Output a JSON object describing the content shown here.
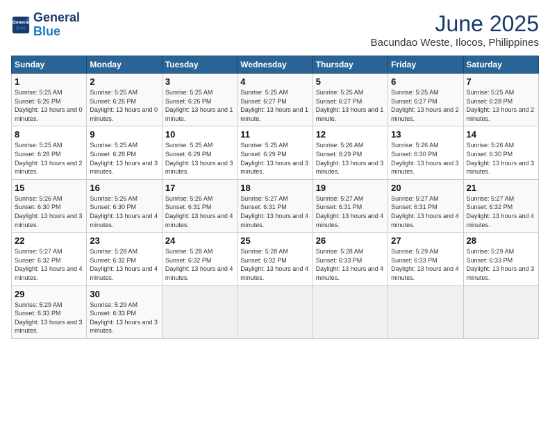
{
  "header": {
    "logo_line1": "General",
    "logo_line2": "Blue",
    "title": "June 2025",
    "subtitle": "Bacundao Weste, Ilocos, Philippines"
  },
  "calendar": {
    "days_of_week": [
      "Sunday",
      "Monday",
      "Tuesday",
      "Wednesday",
      "Thursday",
      "Friday",
      "Saturday"
    ],
    "weeks": [
      [
        {
          "day": "1",
          "info": "Sunrise: 5:25 AM\nSunset: 6:26 PM\nDaylight: 13 hours and 0 minutes."
        },
        {
          "day": "2",
          "info": "Sunrise: 5:25 AM\nSunset: 6:26 PM\nDaylight: 13 hours and 0 minutes."
        },
        {
          "day": "3",
          "info": "Sunrise: 5:25 AM\nSunset: 6:26 PM\nDaylight: 13 hours and 1 minute."
        },
        {
          "day": "4",
          "info": "Sunrise: 5:25 AM\nSunset: 6:27 PM\nDaylight: 13 hours and 1 minute."
        },
        {
          "day": "5",
          "info": "Sunrise: 5:25 AM\nSunset: 6:27 PM\nDaylight: 13 hours and 1 minute."
        },
        {
          "day": "6",
          "info": "Sunrise: 5:25 AM\nSunset: 6:27 PM\nDaylight: 13 hours and 2 minutes."
        },
        {
          "day": "7",
          "info": "Sunrise: 5:25 AM\nSunset: 6:28 PM\nDaylight: 13 hours and 2 minutes."
        }
      ],
      [
        {
          "day": "8",
          "info": "Sunrise: 5:25 AM\nSunset: 6:28 PM\nDaylight: 13 hours and 2 minutes."
        },
        {
          "day": "9",
          "info": "Sunrise: 5:25 AM\nSunset: 6:28 PM\nDaylight: 13 hours and 3 minutes."
        },
        {
          "day": "10",
          "info": "Sunrise: 5:25 AM\nSunset: 6:29 PM\nDaylight: 13 hours and 3 minutes."
        },
        {
          "day": "11",
          "info": "Sunrise: 5:25 AM\nSunset: 6:29 PM\nDaylight: 13 hours and 3 minutes."
        },
        {
          "day": "12",
          "info": "Sunrise: 5:26 AM\nSunset: 6:29 PM\nDaylight: 13 hours and 3 minutes."
        },
        {
          "day": "13",
          "info": "Sunrise: 5:26 AM\nSunset: 6:30 PM\nDaylight: 13 hours and 3 minutes."
        },
        {
          "day": "14",
          "info": "Sunrise: 5:26 AM\nSunset: 6:30 PM\nDaylight: 13 hours and 3 minutes."
        }
      ],
      [
        {
          "day": "15",
          "info": "Sunrise: 5:26 AM\nSunset: 6:30 PM\nDaylight: 13 hours and 3 minutes."
        },
        {
          "day": "16",
          "info": "Sunrise: 5:26 AM\nSunset: 6:30 PM\nDaylight: 13 hours and 4 minutes."
        },
        {
          "day": "17",
          "info": "Sunrise: 5:26 AM\nSunset: 6:31 PM\nDaylight: 13 hours and 4 minutes."
        },
        {
          "day": "18",
          "info": "Sunrise: 5:27 AM\nSunset: 6:31 PM\nDaylight: 13 hours and 4 minutes."
        },
        {
          "day": "19",
          "info": "Sunrise: 5:27 AM\nSunset: 6:31 PM\nDaylight: 13 hours and 4 minutes."
        },
        {
          "day": "20",
          "info": "Sunrise: 5:27 AM\nSunset: 6:31 PM\nDaylight: 13 hours and 4 minutes."
        },
        {
          "day": "21",
          "info": "Sunrise: 5:27 AM\nSunset: 6:32 PM\nDaylight: 13 hours and 4 minutes."
        }
      ],
      [
        {
          "day": "22",
          "info": "Sunrise: 5:27 AM\nSunset: 6:32 PM\nDaylight: 13 hours and 4 minutes."
        },
        {
          "day": "23",
          "info": "Sunrise: 5:28 AM\nSunset: 6:32 PM\nDaylight: 13 hours and 4 minutes."
        },
        {
          "day": "24",
          "info": "Sunrise: 5:28 AM\nSunset: 6:32 PM\nDaylight: 13 hours and 4 minutes."
        },
        {
          "day": "25",
          "info": "Sunrise: 5:28 AM\nSunset: 6:32 PM\nDaylight: 13 hours and 4 minutes."
        },
        {
          "day": "26",
          "info": "Sunrise: 5:28 AM\nSunset: 6:33 PM\nDaylight: 13 hours and 4 minutes."
        },
        {
          "day": "27",
          "info": "Sunrise: 5:29 AM\nSunset: 6:33 PM\nDaylight: 13 hours and 4 minutes."
        },
        {
          "day": "28",
          "info": "Sunrise: 5:29 AM\nSunset: 6:33 PM\nDaylight: 13 hours and 3 minutes."
        }
      ],
      [
        {
          "day": "29",
          "info": "Sunrise: 5:29 AM\nSunset: 6:33 PM\nDaylight: 13 hours and 3 minutes."
        },
        {
          "day": "30",
          "info": "Sunrise: 5:29 AM\nSunset: 6:33 PM\nDaylight: 13 hours and 3 minutes."
        },
        {
          "day": "",
          "info": ""
        },
        {
          "day": "",
          "info": ""
        },
        {
          "day": "",
          "info": ""
        },
        {
          "day": "",
          "info": ""
        },
        {
          "day": "",
          "info": ""
        }
      ]
    ]
  }
}
